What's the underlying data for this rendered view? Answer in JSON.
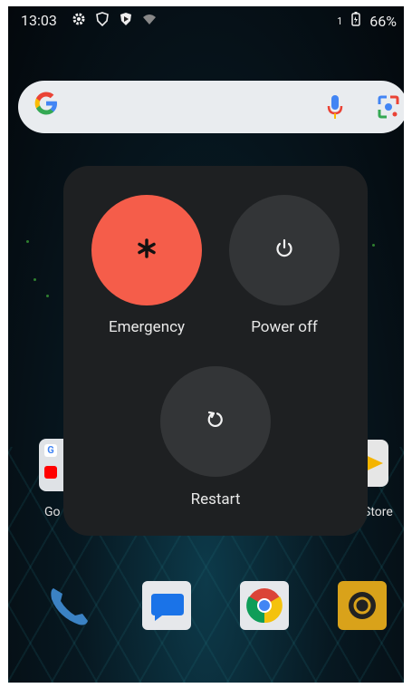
{
  "status_bar": {
    "time": "13:03",
    "sim": "1",
    "battery": "66%"
  },
  "search_bar": {
    "logo": "G"
  },
  "home": {
    "folder_label": "Go",
    "store_label": "Store"
  },
  "power_menu": {
    "emergency_label": "Emergency",
    "power_off_label": "Power off",
    "restart_label": "Restart",
    "emergency_color": "#f55d4a",
    "button_color": "#333537",
    "panel_color": "#1e2022"
  }
}
